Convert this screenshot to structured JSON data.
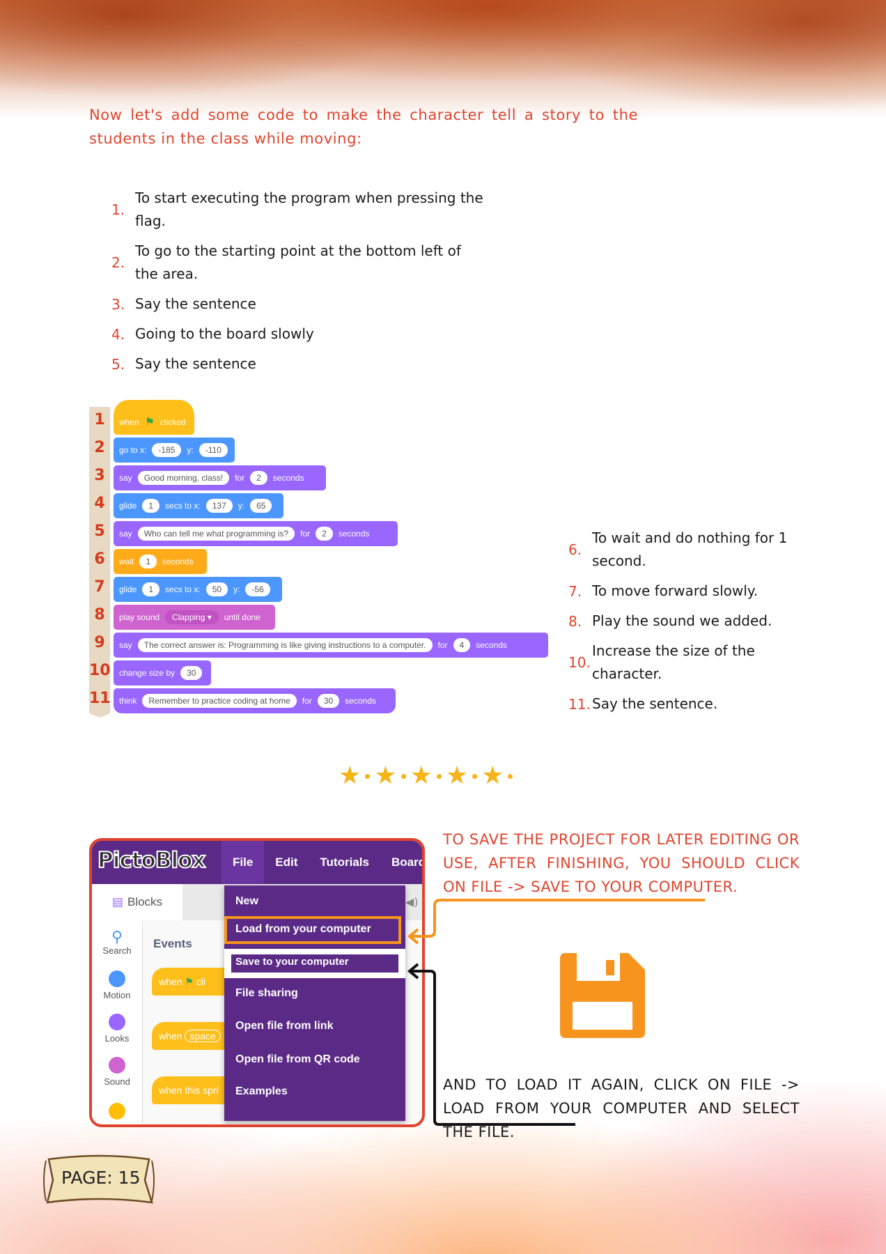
{
  "intro": "Now let's add some code to make the character tell a story to the students in the class while moving:",
  "steps_left": [
    {
      "n": "1.",
      "text": "To start executing the program when pressing the flag."
    },
    {
      "n": "2.",
      "text": "To go to the starting point at the bottom left of the area."
    },
    {
      "n": "3.",
      "text": "Say the sentence"
    },
    {
      "n": "4.",
      "text": "Going to the board slowly"
    },
    {
      "n": "5.",
      "text": "Say the sentence"
    }
  ],
  "steps_right": [
    {
      "n": "6.",
      "text": "To wait and do nothing for 1 second."
    },
    {
      "n": "7.",
      "text": "To move forward slowly."
    },
    {
      "n": "8.",
      "text": "Play the sound we added."
    },
    {
      "n": "10.",
      "text": "Increase the size of the character."
    },
    {
      "n": "11.",
      "text": "Say the sentence."
    }
  ],
  "code": {
    "line_numbers": [
      "1",
      "2",
      "3",
      "4",
      "5",
      "6",
      "7",
      "8",
      "9",
      "10",
      "11"
    ],
    "b1": {
      "a": "when",
      "b": "clicked"
    },
    "b2": {
      "a": "go to x:",
      "x": "-185",
      "b": "y:",
      "y": "-110"
    },
    "b3": {
      "a": "say",
      "msg": "Good morning, class!",
      "b": "for",
      "n": "2",
      "c": "seconds"
    },
    "b4": {
      "a": "glide",
      "n": "1",
      "b": "secs to x:",
      "x": "137",
      "c": "y:",
      "y": "65"
    },
    "b5": {
      "a": "say",
      "msg": "Who can tell me what programming is?",
      "b": "for",
      "n": "2",
      "c": "seconds"
    },
    "b6": {
      "a": "wait",
      "n": "1",
      "b": "seconds"
    },
    "b7": {
      "a": "glide",
      "n": "1",
      "b": "secs to x:",
      "x": "50",
      "c": "y:",
      "y": "-56"
    },
    "b8": {
      "a": "play sound",
      "sound": "Clapping",
      "b": "until done"
    },
    "b9": {
      "a": "say",
      "msg": "The correct answer is: Programming is like giving instructions to a computer.",
      "b": "for",
      "n": "4",
      "c": "seconds"
    },
    "b10": {
      "a": "change size by",
      "n": "30"
    },
    "b11": {
      "a": "think",
      "msg": "Remember to practice coding at home",
      "b": "for",
      "n": "30",
      "c": "seconds"
    }
  },
  "screenshot": {
    "logo": "PictoBlox",
    "menu": [
      "File",
      "Edit",
      "Tutorials",
      "Board"
    ],
    "tab": "Blocks",
    "categories": [
      "Search",
      "Motion",
      "Looks",
      "Sound"
    ],
    "events_title": "Events",
    "event_blocks": [
      "when",
      "when",
      "when this spri"
    ],
    "event_block_extras": [
      "cli",
      "space"
    ],
    "file_menu": [
      "New",
      "Load from your computer",
      "Save to your computer",
      "File sharing",
      "Open file from link",
      "Open file from QR code",
      "Examples"
    ]
  },
  "notes": {
    "save": "TO SAVE THE PROJECT FOR LATER EDITING OR USE, AFTER FINISHING, YOU SHOULD CLICK ON FILE -> SAVE TO YOUR COMPUTER.",
    "load": "AND TO LOAD IT AGAIN, CLICK ON FILE -> LOAD FROM YOUR COMPUTER AND SELECT THE FILE."
  },
  "page_label": "PAGE: 15",
  "colors": {
    "accent_red": "#e0432d",
    "accent_orange": "#f7941d",
    "pictoblox_purple": "#5b2a86"
  }
}
